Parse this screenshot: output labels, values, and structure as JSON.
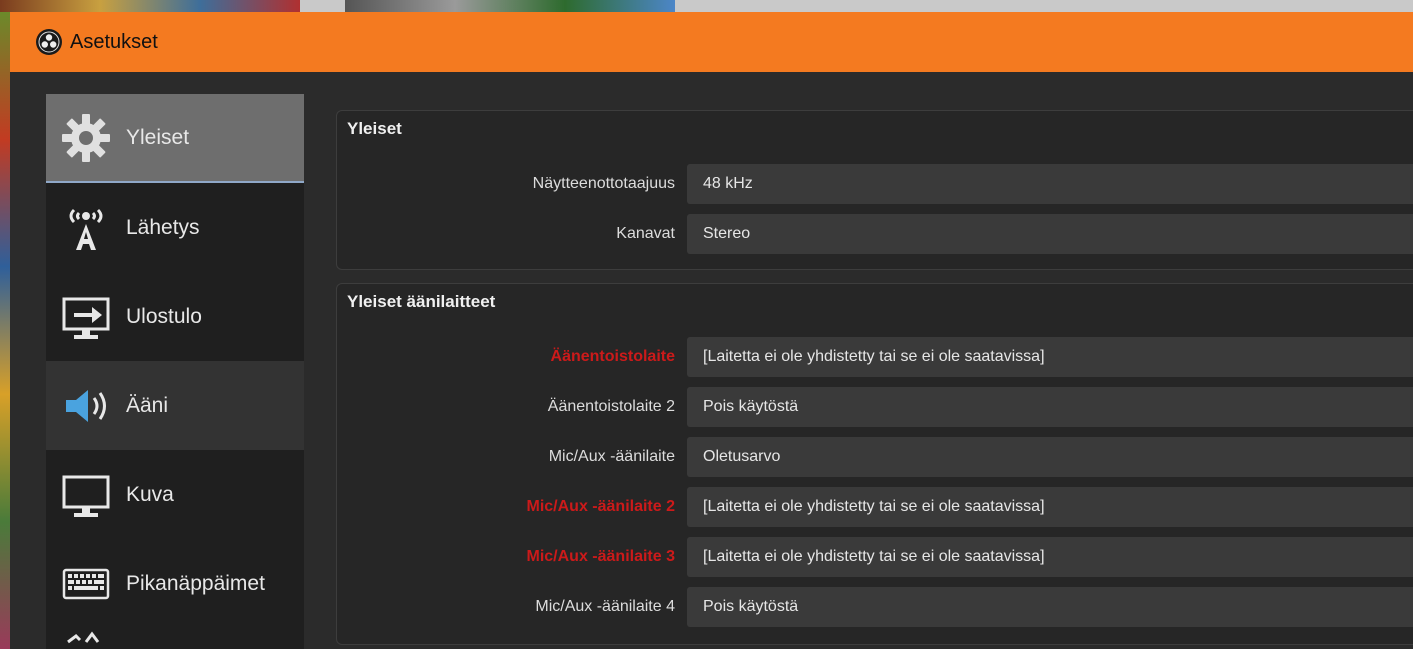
{
  "window": {
    "title": "Asetukset"
  },
  "sidebar": {
    "items": [
      {
        "label": "Yleiset",
        "icon": "gear-icon",
        "state": "selected"
      },
      {
        "label": "Lähetys",
        "icon": "broadcast-antenna-icon",
        "state": "normal"
      },
      {
        "label": "Ulostulo",
        "icon": "output-monitor-icon",
        "state": "normal"
      },
      {
        "label": "Ääni",
        "icon": "speaker-icon",
        "state": "hover"
      },
      {
        "label": "Kuva",
        "icon": "monitor-icon",
        "state": "normal"
      },
      {
        "label": "Pikanäppäimet",
        "icon": "keyboard-icon",
        "state": "normal"
      }
    ]
  },
  "general": {
    "title": "Yleiset",
    "rows": [
      {
        "label": "Näytteenottotaajuus",
        "value": "48 kHz"
      },
      {
        "label": "Kanavat",
        "value": "Stereo"
      }
    ]
  },
  "devices": {
    "title": "Yleiset äänilaitteet",
    "rows": [
      {
        "label": "Äänentoistolaite",
        "value": "[Laitetta ei ole yhdistetty tai se ei ole saatavissa]",
        "error": true
      },
      {
        "label": "Äänentoistolaite 2",
        "value": "Pois käytöstä",
        "error": false
      },
      {
        "label": "Mic/Aux -äänilaite",
        "value": "Oletusarvo",
        "error": false
      },
      {
        "label": "Mic/Aux -äänilaite 2",
        "value": "[Laitetta ei ole yhdistetty tai se ei ole saatavissa]",
        "error": true
      },
      {
        "label": "Mic/Aux -äänilaite 3",
        "value": "[Laitetta ei ole yhdistetty tai se ei ole saatavissa]",
        "error": true
      },
      {
        "label": "Mic/Aux -äänilaite 4",
        "value": "Pois käytöstä",
        "error": false
      }
    ]
  },
  "colors": {
    "titlebar": "#f47a20",
    "error_label": "#cc1a1a",
    "panel": "#262626",
    "field": "#3a3a3a"
  }
}
